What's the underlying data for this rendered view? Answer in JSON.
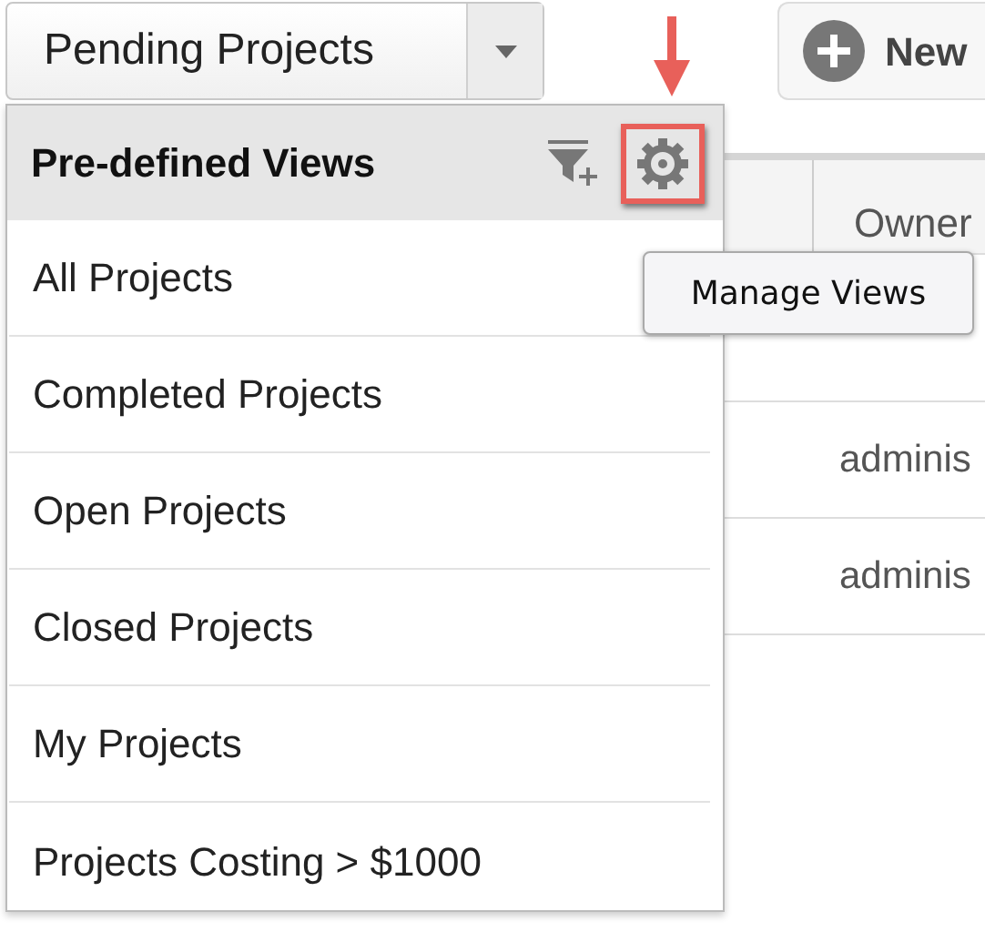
{
  "view_selector": {
    "label": "Pending Projects"
  },
  "new_button": {
    "label": "New"
  },
  "table": {
    "columns": [
      "Owner"
    ],
    "rows": [
      [
        "adminis"
      ],
      [
        "adminis"
      ]
    ]
  },
  "menu": {
    "title": "Pre-defined Views",
    "items": [
      {
        "label": "All Projects"
      },
      {
        "label": "Completed Projects"
      },
      {
        "label": "Open Projects"
      },
      {
        "label": "Closed Projects"
      },
      {
        "label": "My Projects"
      },
      {
        "label": "Projects Costing > $1000"
      }
    ]
  },
  "tooltip": {
    "text": "Manage Views"
  }
}
